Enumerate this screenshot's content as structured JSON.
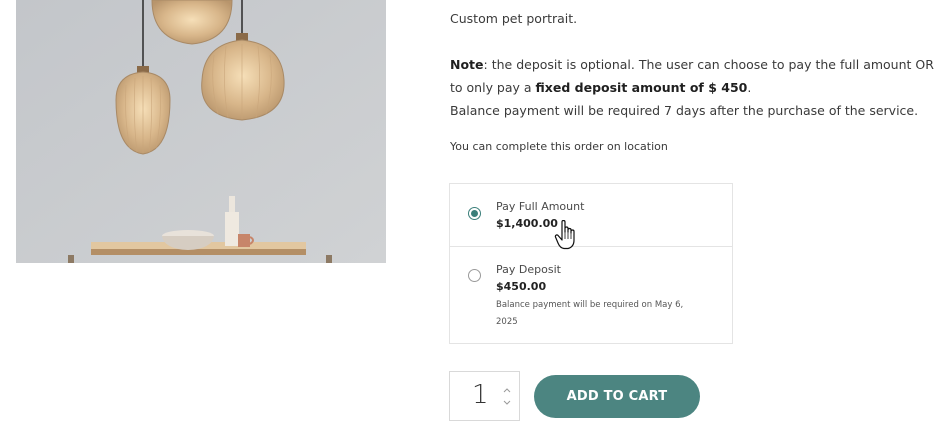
{
  "product": {
    "description": "Custom pet portrait.",
    "note_label": "Note",
    "note_text_1": ": the deposit is optional. The user can choose to pay the full amount OR",
    "note_text_2_prefix": "to only pay a ",
    "note_text_2_bold": "fixed deposit amount of $ 450",
    "note_text_2_suffix": ".",
    "note_text_3": "Balance payment will be required 7 days after the purchase of the service.",
    "location_text": "You can complete this order on location"
  },
  "payment_options": [
    {
      "title": "Pay Full Amount",
      "price": "$1,400.00",
      "selected": true
    },
    {
      "title": "Pay Deposit",
      "price": "$450.00",
      "note": "Balance payment will be required on May 6, 2025",
      "selected": false
    }
  ],
  "cart": {
    "quantity": "1",
    "up_icon": "chevron-up-icon",
    "down_icon": "chevron-down-icon",
    "add_label": "ADD TO CART"
  },
  "colors": {
    "accent": "#4c8581",
    "radio_selected": "#3b7f7a"
  },
  "icons": {
    "cursor": "hand-pointer-icon"
  }
}
